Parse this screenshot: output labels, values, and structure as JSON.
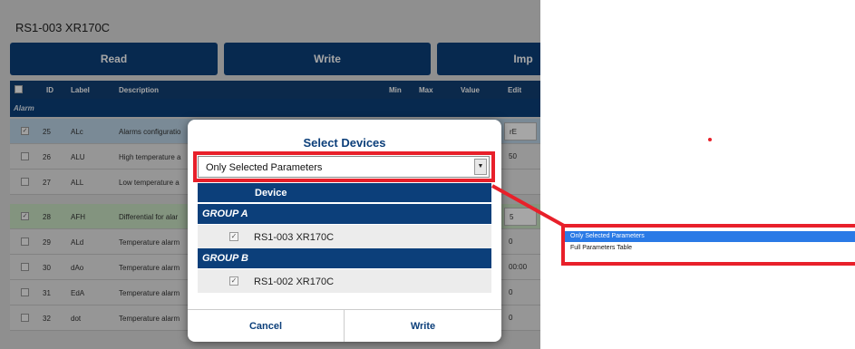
{
  "app": {
    "title": "RS1-003 XR170C",
    "buttons": {
      "read": "Read",
      "write": "Write",
      "import": "Imp"
    }
  },
  "table": {
    "headers": {
      "id": "ID",
      "label": "Label",
      "description": "Description",
      "min": "Min",
      "max": "Max",
      "value": "Value",
      "edit": "Edit"
    },
    "section": "Alarm",
    "rows": [
      {
        "checked": true,
        "id": "25",
        "label": "ALc",
        "description": "Alarms configuratio",
        "edit": "rE"
      },
      {
        "checked": false,
        "id": "26",
        "label": "ALU",
        "description": "High temperature a",
        "edit": "50"
      },
      {
        "checked": false,
        "id": "27",
        "label": "ALL",
        "description": "Low temperature a",
        "edit": ""
      },
      {
        "checked": true,
        "id": "28",
        "label": "AFH",
        "description": "Differential for alar",
        "edit": "5"
      },
      {
        "checked": false,
        "id": "29",
        "label": "ALd",
        "description": "Temperature alarm",
        "edit": "0"
      },
      {
        "checked": false,
        "id": "30",
        "label": "dAo",
        "description": "Temperature alarm",
        "edit": "00:00"
      },
      {
        "checked": false,
        "id": "31",
        "label": "EdA",
        "description": "Temperature alarm",
        "edit": "0"
      },
      {
        "checked": false,
        "id": "32",
        "label": "dot",
        "description": "Temperature alarm",
        "edit": "0"
      }
    ]
  },
  "modal": {
    "title": "Select Devices",
    "select_value": "Only Selected Parameters",
    "device_header": "Device",
    "groups": [
      {
        "name": "GROUP A",
        "devices": [
          {
            "name": "RS1-003 XR170C",
            "checked": true
          }
        ]
      },
      {
        "name": "GROUP B",
        "devices": [
          {
            "name": "RS1-002 XR170C",
            "checked": true
          }
        ]
      }
    ],
    "cancel": "Cancel",
    "write": "Write"
  },
  "dropdown": {
    "options": [
      "Only Selected Parameters",
      "Full Parameters Table"
    ],
    "selected": "Only Selected Parameters"
  },
  "colors": {
    "brand": "#0c3f7a",
    "highlight": "#e8202a",
    "option_selected": "#2a7ae6"
  }
}
